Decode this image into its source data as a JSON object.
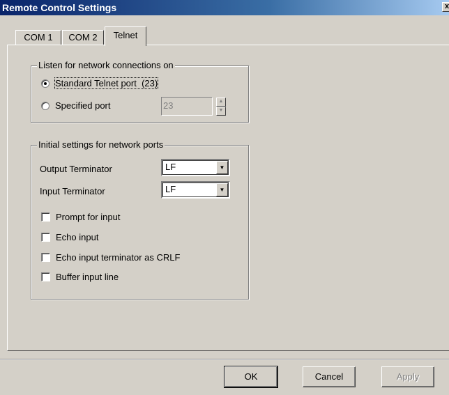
{
  "window": {
    "title": "Remote Control Settings",
    "close_label": "x"
  },
  "tabs": [
    {
      "label": "COM 1",
      "active": false
    },
    {
      "label": "COM 2",
      "active": false
    },
    {
      "label": "Telnet",
      "active": true
    }
  ],
  "listen_group": {
    "legend": "Listen for network connections on",
    "standard_port_label": "Standard Telnet port",
    "standard_port_value": "(23)",
    "standard_selected": true,
    "specified_port_label": "Specified port",
    "specified_port_value": "23",
    "specified_selected": false
  },
  "initial_group": {
    "legend": "Initial settings for network ports",
    "output_terminator_label": "Output Terminator",
    "output_terminator_value": "LF",
    "input_terminator_label": "Input Terminator",
    "input_terminator_value": "LF",
    "checkboxes": [
      {
        "label": "Prompt for input",
        "checked": false
      },
      {
        "label": "Echo input",
        "checked": false
      },
      {
        "label": "Echo input terminator as CRLF",
        "checked": false
      },
      {
        "label": "Buffer input line",
        "checked": false
      }
    ]
  },
  "buttons": {
    "ok": "OK",
    "cancel": "Cancel",
    "apply": "Apply"
  }
}
